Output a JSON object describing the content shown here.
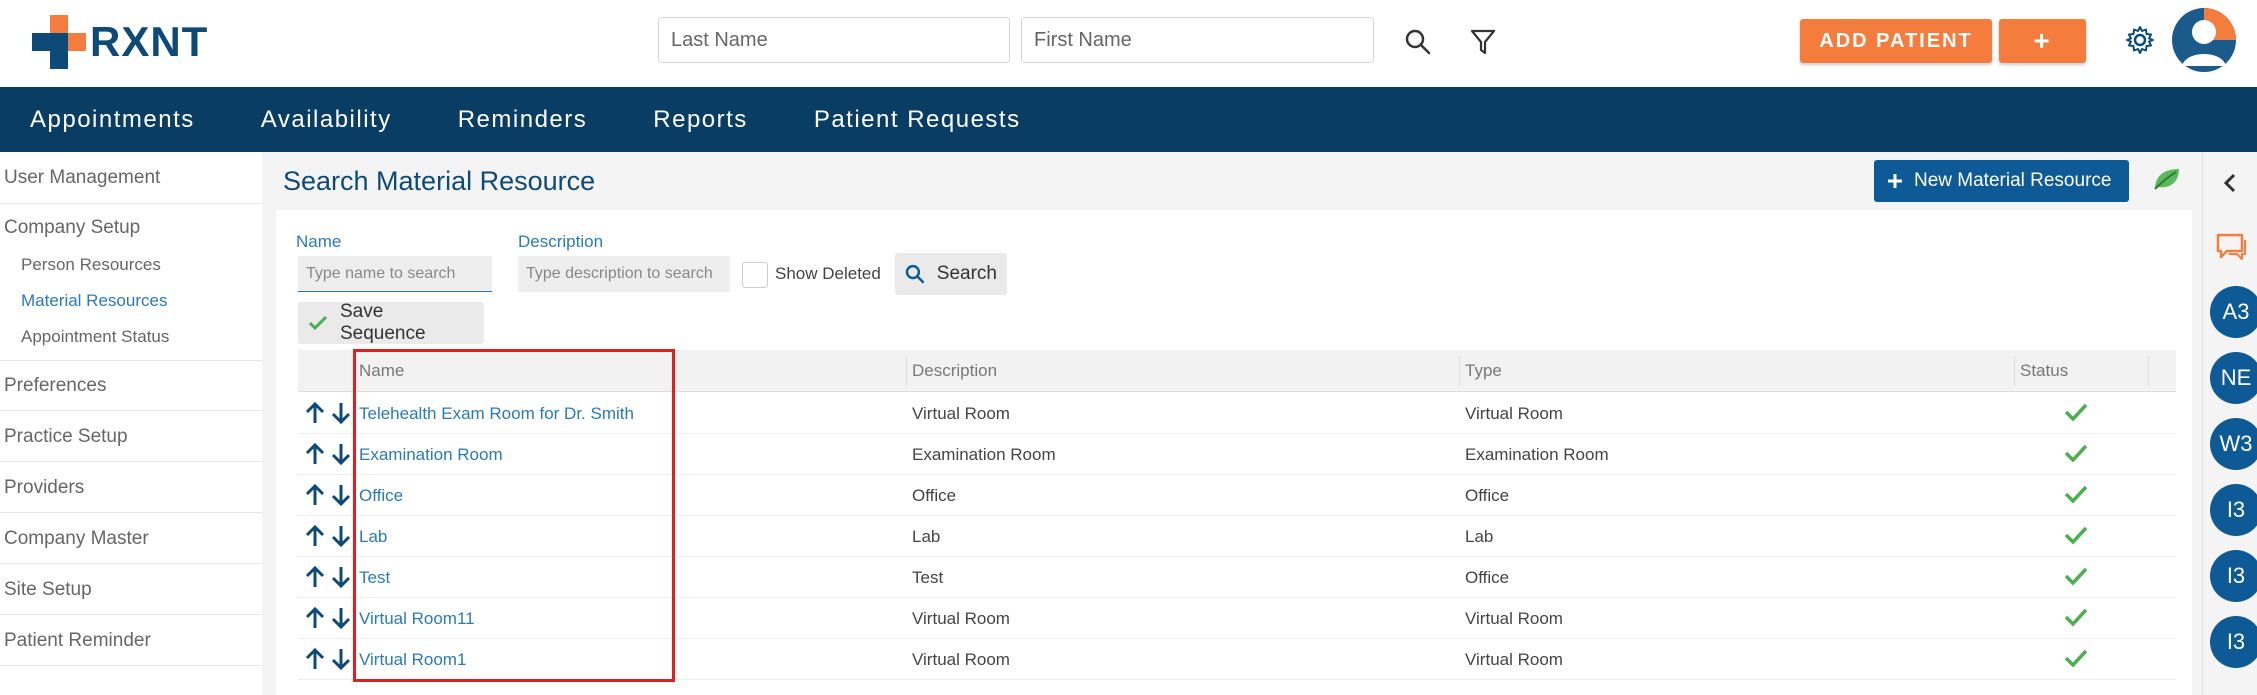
{
  "header": {
    "logo_text": "RXNT",
    "last_name_placeholder": "Last Name",
    "first_name_placeholder": "First Name",
    "add_patient_label": "ADD PATIENT",
    "plus_label": "+"
  },
  "nav": {
    "items": [
      "Appointments",
      "Availability",
      "Reminders",
      "Reports",
      "Patient Requests"
    ]
  },
  "sidebar": {
    "items": [
      {
        "label": "User Management"
      },
      {
        "label": "Company Setup"
      },
      {
        "label": "Person Resources"
      },
      {
        "label": "Material Resources"
      },
      {
        "label": "Appointment Status"
      },
      {
        "label": "Preferences"
      },
      {
        "label": "Practice Setup"
      },
      {
        "label": "Providers"
      },
      {
        "label": "Company Master"
      },
      {
        "label": "Site Setup"
      },
      {
        "label": "Patient Reminder"
      }
    ],
    "active_item": "Material Resources"
  },
  "main": {
    "title": "Search Material Resource",
    "new_button_label": "New Material Resource",
    "name_label": "Name",
    "name_placeholder": "Type name to search",
    "description_label": "Description",
    "description_placeholder": "Type description to search",
    "show_deleted_label": "Show Deleted",
    "search_button_label": "Search",
    "save_sequence_label": "Save Sequence"
  },
  "table": {
    "columns": [
      "Name",
      "Description",
      "Type",
      "Status"
    ],
    "rows": [
      {
        "name": "Telehealth Exam Room for Dr. Smith",
        "description": "Virtual Room",
        "type": "Virtual Room"
      },
      {
        "name": "Examination Room",
        "description": "Examination Room",
        "type": "Examination Room"
      },
      {
        "name": "Office",
        "description": "Office",
        "type": "Office"
      },
      {
        "name": "Lab",
        "description": "Lab",
        "type": "Lab"
      },
      {
        "name": "Test",
        "description": "Test",
        "type": "Office"
      },
      {
        "name": "Virtual Room11",
        "description": "Virtual Room",
        "type": "Virtual Room"
      },
      {
        "name": "Virtual Room1",
        "description": "Virtual Room",
        "type": "Virtual Room"
      }
    ]
  },
  "rail": {
    "bubbles": [
      "A3",
      "NE",
      "W3",
      "I3",
      "I3",
      "I3"
    ]
  },
  "colors": {
    "brand_navy": "#0a3d63",
    "accent_orange": "#f47c3c",
    "link_blue": "#2a7ab8",
    "status_green": "#4caf50",
    "highlight_red": "#e02020"
  }
}
